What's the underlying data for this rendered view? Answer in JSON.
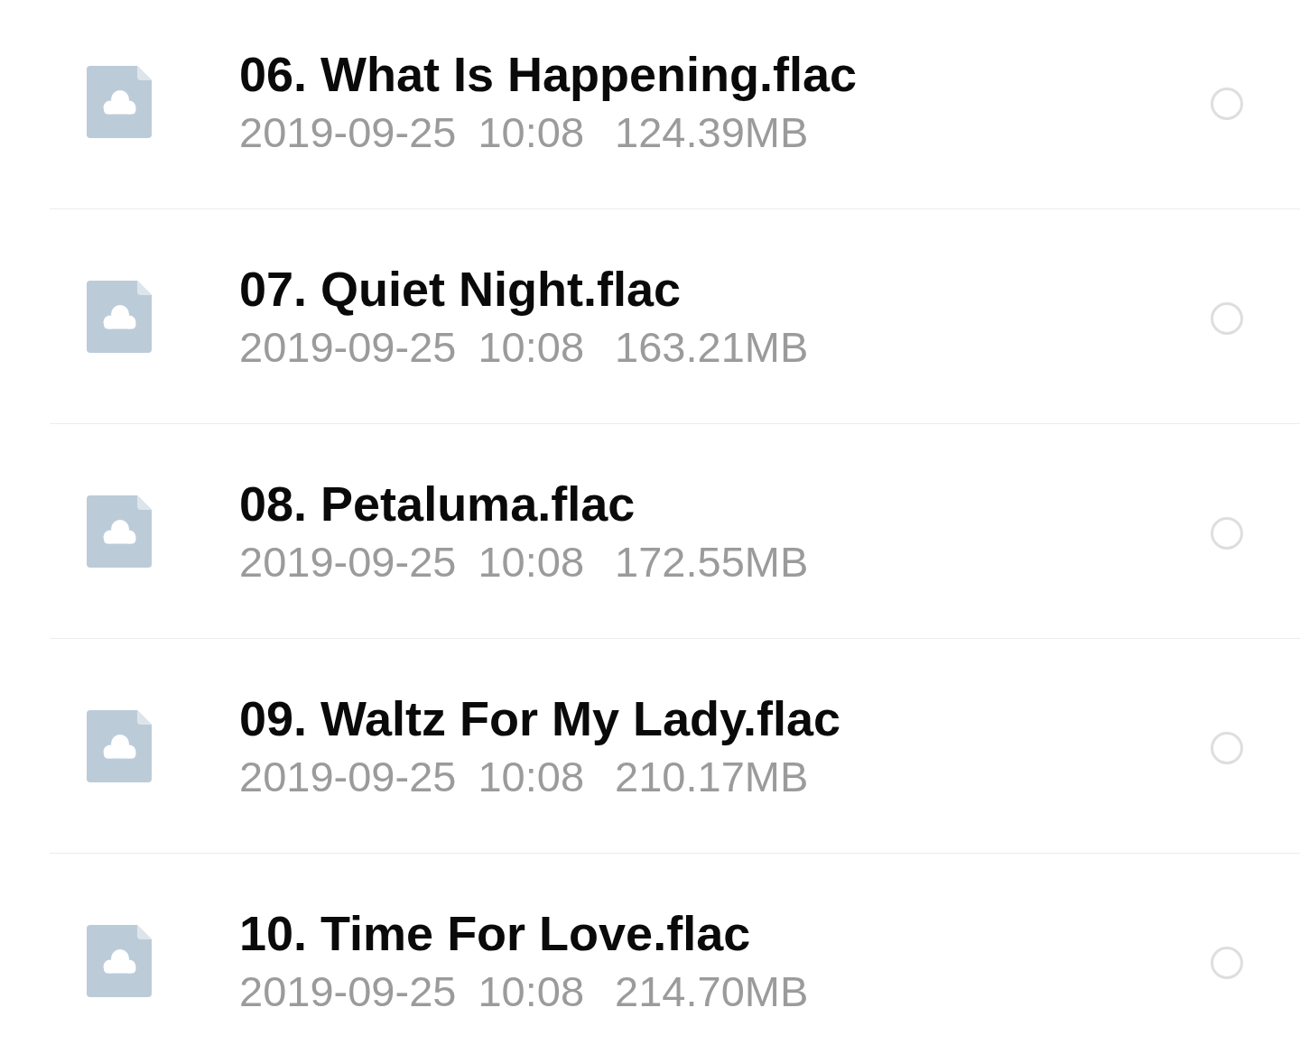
{
  "files": [
    {
      "name": "06. What Is Happening.flac",
      "date": "2019-09-25",
      "time": "10:08",
      "size": "124.39MB",
      "selected": false
    },
    {
      "name": "07. Quiet Night.flac",
      "date": "2019-09-25",
      "time": "10:08",
      "size": "163.21MB",
      "selected": false
    },
    {
      "name": "08. Petaluma.flac",
      "date": "2019-09-25",
      "time": "10:08",
      "size": "172.55MB",
      "selected": false
    },
    {
      "name": "09. Waltz For My Lady.flac",
      "date": "2019-09-25",
      "time": "10:08",
      "size": "210.17MB",
      "selected": false
    },
    {
      "name": "10. Time For Love.flac",
      "date": "2019-09-25",
      "time": "10:08",
      "size": "214.70MB",
      "selected": false
    }
  ]
}
